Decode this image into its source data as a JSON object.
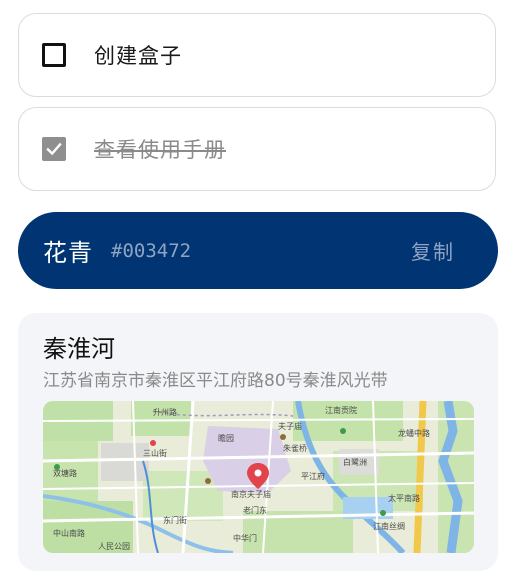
{
  "tasks": {
    "create_box": {
      "label": "创建盒子",
      "checked": false
    },
    "view_manual": {
      "label": "查看使用手册",
      "checked": true
    }
  },
  "color_card": {
    "name": "花青",
    "hex": "#003472",
    "copy_label": "复制",
    "background": "#003472"
  },
  "place": {
    "name": "秦淮河",
    "address": "江苏省南京市秦淮区平江府路80号秦淮风光带",
    "map_labels": {
      "renmin_park": "人民公园",
      "zhongshan_south": "中山南路",
      "zhonghua_gate": "中华门",
      "fuzimiao": "夫子庙",
      "confucius_temple": "南京夫子庙",
      "pingjiang_road": "平江府",
      "shuangtang_road": "双塘路",
      "sanshan_street": "三山街",
      "laomendong": "老门东",
      "zhanyuan": "瞻园",
      "bailuzhou": "白鹭洲",
      "jiangnan_examination": "江南贡院",
      "longpan_road": "龙蟠中路",
      "shengzhou_road": "升州路",
      "dongmen_street": "东门街",
      "zhuque_bridge": "朱雀桥",
      "taiping_south": "太平南路",
      "jiangnan_silk": "江南丝绸"
    }
  }
}
